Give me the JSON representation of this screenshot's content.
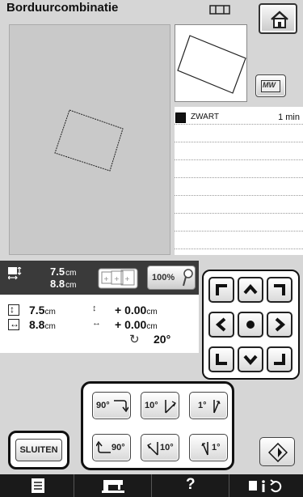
{
  "header": {
    "title": "Borduurcombinatie"
  },
  "thread_list": {
    "items": [
      {
        "name": "ZWART",
        "time": "1 min",
        "color": "#111111"
      }
    ]
  },
  "info_bar": {
    "width_value": "7.5",
    "height_value": "8.8",
    "unit": "cm",
    "zoom_label": "100%"
  },
  "position": {
    "height_value": "7.5",
    "width_value": "8.8",
    "unit": "cm",
    "offset_y": "+ 0.00",
    "offset_x": "+ 0.00",
    "rotation": "20°"
  },
  "rotation_buttons": {
    "rot90_right": "90°",
    "rot10_right": "10°",
    "rot1_right": "1°",
    "rot90_left": "90°",
    "rot10_left": "10°",
    "rot1_left": "1°"
  },
  "close_label": "SLUITEN",
  "icons": {
    "home": "home-icon",
    "hoop": "hoop-icon",
    "mirror": "mirror-mw-icon",
    "flip": "flip-icon",
    "help": "?",
    "zoom": "zoom-lens-icon"
  },
  "colors": {
    "background": "#d6d6d6",
    "info_bar": "#3a3a3a",
    "bottom_bar": "#1a1a1a"
  }
}
